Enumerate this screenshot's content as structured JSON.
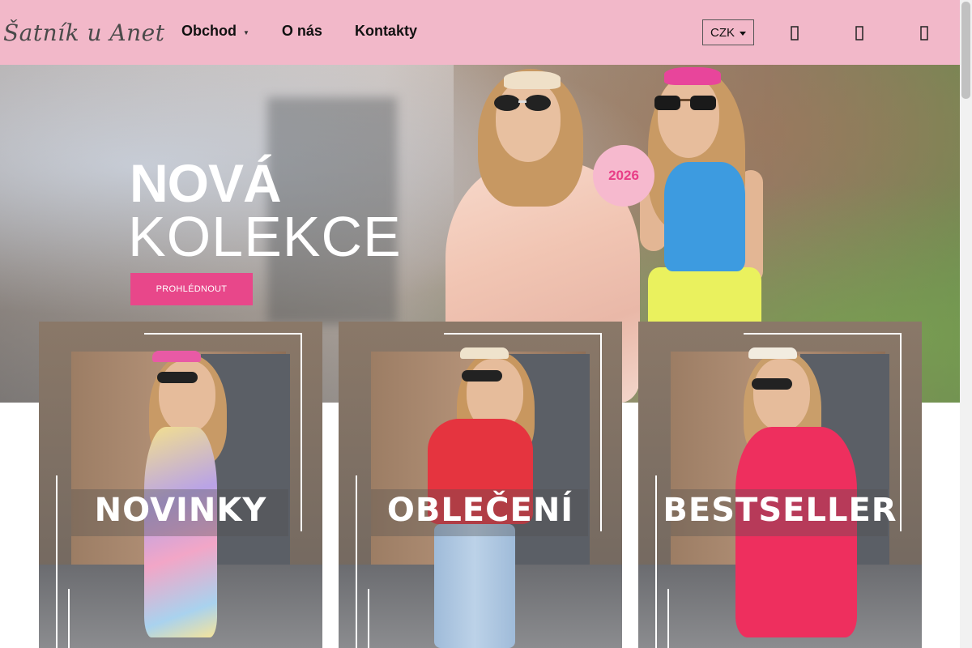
{
  "header": {
    "logo": "Šatník u Anet",
    "nav": [
      {
        "label": "Obchod",
        "has_dropdown": true
      },
      {
        "label": "O nás"
      },
      {
        "label": "Kontakty"
      }
    ],
    "currency": "CZK",
    "icons": [
      "search-icon",
      "user-icon",
      "cart-icon"
    ]
  },
  "hero": {
    "title_line1": "NOVÁ",
    "title_line2": "KOLEKCE",
    "cta": "PROHLÉDNOUT",
    "year_badge": "2026"
  },
  "categories": [
    {
      "label": "NOVINKY"
    },
    {
      "label": "OBLEČENÍ"
    },
    {
      "label": "BESTSELLER"
    }
  ],
  "colors": {
    "header_bg": "#f2b8c9",
    "accent_pink": "#e8478a",
    "badge_bg": "#f6b9ce"
  }
}
